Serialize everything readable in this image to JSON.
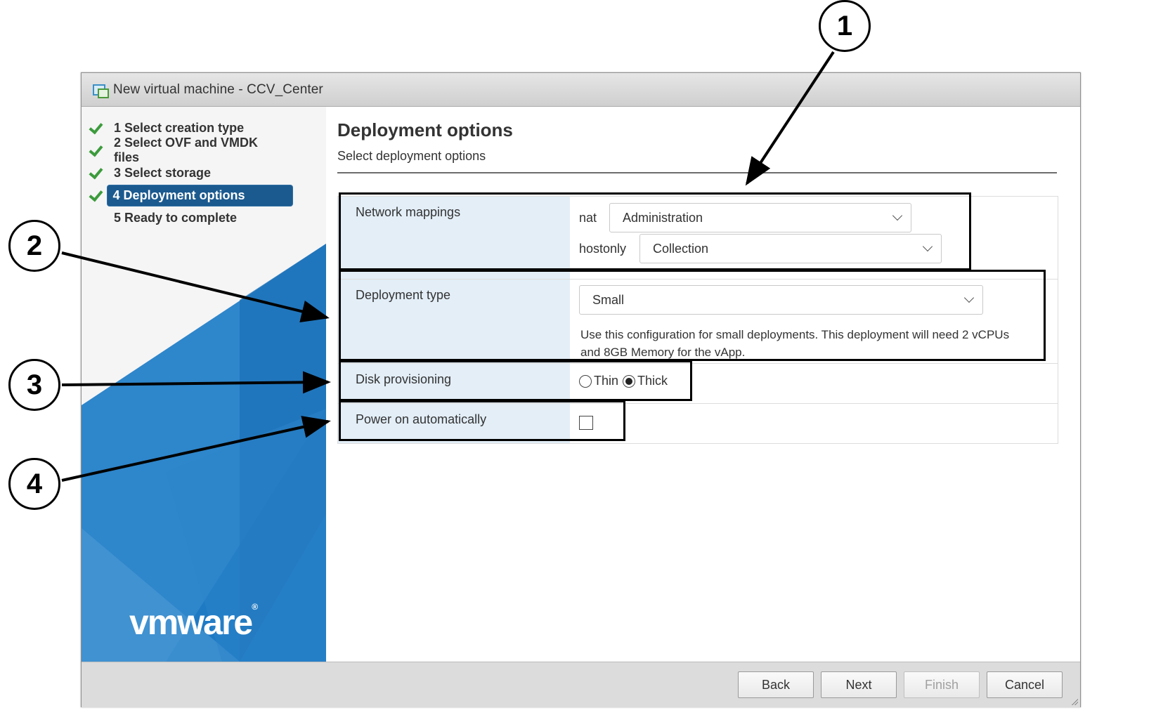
{
  "window": {
    "title": "New virtual machine - CCV_Center",
    "icon": "vm-new-icon"
  },
  "sidebar": {
    "steps": [
      {
        "label": "1  Select creation type",
        "done": true,
        "active": false
      },
      {
        "label": "2  Select OVF and VMDK files",
        "done": true,
        "active": false
      },
      {
        "label": "3  Select storage",
        "done": true,
        "active": false
      },
      {
        "label": "4 Deployment options",
        "done": true,
        "active": true
      },
      {
        "label": "5  Ready to complete",
        "done": false,
        "active": false
      }
    ],
    "logo_text": "vmware",
    "logo_mark": "®"
  },
  "main": {
    "title": "Deployment options",
    "subtitle": "Select deployment options",
    "network_mappings": {
      "label": "Network mappings",
      "mappings": [
        {
          "name": "nat",
          "value": "Administration"
        },
        {
          "name": "hostonly",
          "value": "Collection"
        }
      ]
    },
    "deployment_type": {
      "label": "Deployment type",
      "value": "Small",
      "description": "Use this configuration for small deployments. This deployment will need 2 vCPUs and 8GB Memory for the vApp."
    },
    "disk_provisioning": {
      "label": "Disk provisioning",
      "options": [
        "Thin",
        "Thick"
      ],
      "selected": "Thick"
    },
    "power_on": {
      "label": "Power on automatically",
      "checked": false
    }
  },
  "footer": {
    "back": "Back",
    "next": "Next",
    "finish": "Finish",
    "cancel": "Cancel"
  },
  "callouts": [
    "1",
    "2",
    "3",
    "4"
  ],
  "colors": {
    "active_step": "#1b5a8f",
    "check": "#3c9b3c",
    "label_bg": "#e3eef7",
    "brand_blue": "#1f7ac4"
  }
}
